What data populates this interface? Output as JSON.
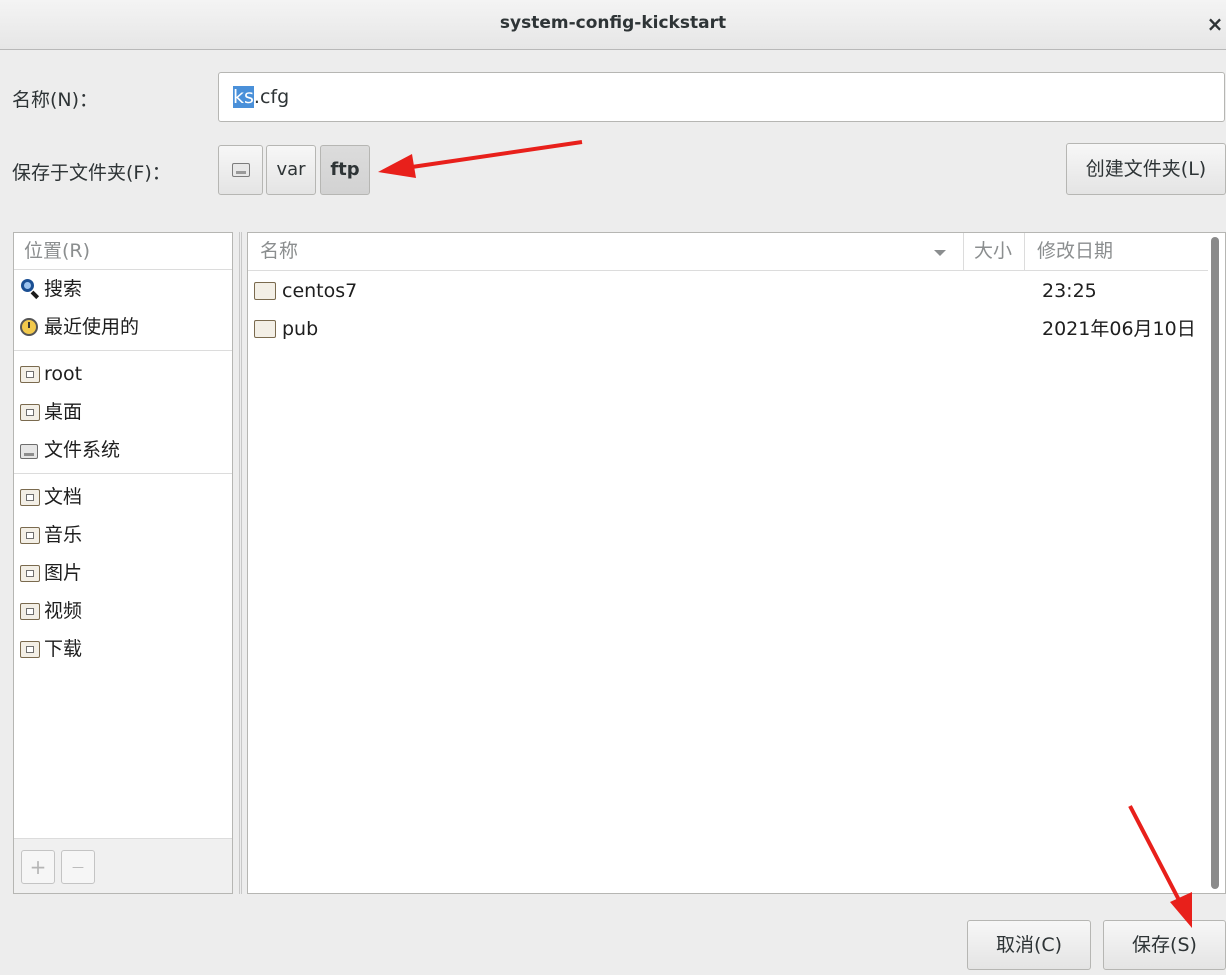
{
  "window": {
    "title": "system-config-kickstart",
    "close_glyph": "×"
  },
  "name_row": {
    "label": "名称(N)：",
    "value_selected": "ks",
    "value_rest": ".cfg"
  },
  "folder_row": {
    "label": "保存于文件夹(F)：",
    "path": [
      {
        "label": "",
        "icon": "drive-icon"
      },
      {
        "label": "var"
      },
      {
        "label": "ftp",
        "active": true
      }
    ],
    "create_folder_label": "创建文件夹(L)"
  },
  "places": {
    "header": "位置(R)",
    "items": [
      {
        "label": "搜索",
        "icon": "search-icon"
      },
      {
        "label": "最近使用的",
        "icon": "recent-icon"
      },
      {
        "label": "root",
        "icon": "home-folder-icon"
      },
      {
        "label": "桌面",
        "icon": "desktop-folder-icon"
      },
      {
        "label": "文件系统",
        "icon": "filesystem-icon"
      },
      {
        "label": "文档",
        "icon": "documents-folder-icon"
      },
      {
        "label": "音乐",
        "icon": "music-folder-icon"
      },
      {
        "label": "图片",
        "icon": "pictures-folder-icon"
      },
      {
        "label": "视频",
        "icon": "videos-folder-icon"
      },
      {
        "label": "下载",
        "icon": "downloads-folder-icon"
      }
    ],
    "add_label": "+",
    "remove_label": "—"
  },
  "files": {
    "columns": {
      "name": "名称",
      "size": "大小",
      "modified": "修改日期"
    },
    "rows": [
      {
        "name": "centos7",
        "modified": "23:25",
        "icon": "folder-icon"
      },
      {
        "name": "pub",
        "modified": "2021年06月10日",
        "icon": "folder-icon"
      }
    ]
  },
  "actions": {
    "cancel_label": "取消(C)",
    "save_label": "保存(S)"
  },
  "colors": {
    "selection": "#4a90d9",
    "annotation_arrow": "#e8201b"
  }
}
